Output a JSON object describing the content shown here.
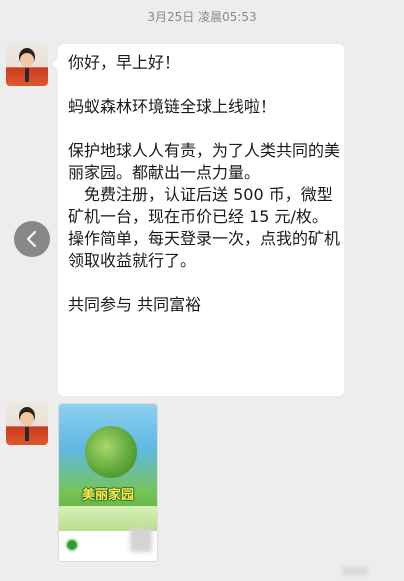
{
  "header": {
    "timestamp": "3月25日 凌晨05:53"
  },
  "messages": [
    {
      "sender": "contact",
      "type": "text",
      "text": "你好，早上好！\n\n蚂蚁森林环境链全球上线啦！\n\n保护地球人人有责，为了人类共同的美丽家园。都献出一点力量。\n　免费注册，认证后送 500 币，微型矿机一台，现在币价已经 15 元/枚。\n操作简单，每天登录一次，点我的矿机领取收益就行了。\n\n共同参与 共同富裕"
    },
    {
      "sender": "contact",
      "type": "image",
      "poster_title": "美丽家园"
    }
  ],
  "icons": {
    "back": "chevron-left-icon",
    "avatar": "contact-avatar"
  },
  "colors": {
    "background": "#ededed",
    "bubble": "#ffffff",
    "back_button": "#7d7d7d"
  }
}
